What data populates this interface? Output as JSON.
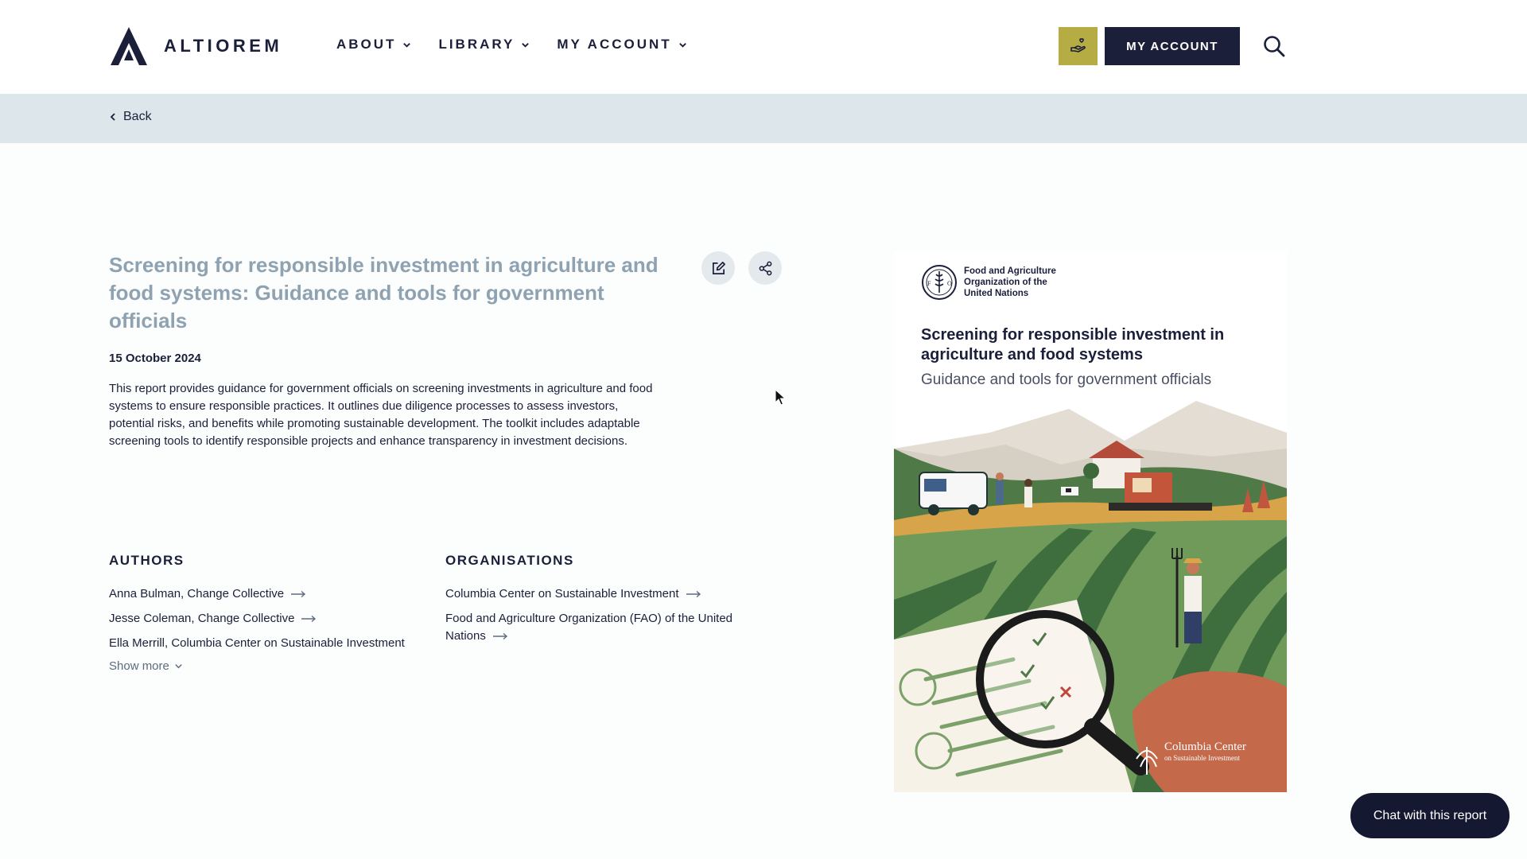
{
  "header": {
    "logo_text": "ALTIOREM",
    "nav": [
      {
        "label": "ABOUT"
      },
      {
        "label": "LIBRARY"
      },
      {
        "label": "MY ACCOUNT"
      }
    ],
    "account_button": "MY ACCOUNT"
  },
  "backbar": {
    "back_label": "Back"
  },
  "report": {
    "title": "Screening for responsible investment in agriculture and food systems: Guidance and tools for government officials",
    "date": "15 October 2024",
    "description": "This report provides guidance for government officials on screening investments in agriculture and food systems to ensure responsible practices. It outlines due diligence processes to assess investors, potential risks, and benefits while promoting sustainable development. The toolkit includes adaptable screening tools to identify responsible projects and enhance transparency in investment decisions."
  },
  "authors": {
    "heading": "AUTHORS",
    "items": [
      "Anna Bulman, Change Collective",
      "Jesse Coleman, Change Collective",
      "Ella Merrill, Columbia Center on Sustainable Investment"
    ],
    "show_more": "Show more"
  },
  "organisations": {
    "heading": "ORGANISATIONS",
    "items": [
      "Columbia Center on Sustainable Investment",
      "Food and Agriculture Organization (FAO) of the United Nations"
    ]
  },
  "cover": {
    "org_name": "Food and Agriculture Organization of the United Nations",
    "title": "Screening for responsible investment in agriculture and food systems",
    "subtitle": "Guidance and tools for government officials",
    "partner_name": "Columbia Center",
    "partner_sub": "on Sustainable Investment"
  },
  "chat_button": "Chat with this report",
  "colors": {
    "navy": "#1b1f3a",
    "title_muted": "#8ea2b1",
    "backbar": "#dde6ea",
    "donate": "#b5ad44"
  }
}
